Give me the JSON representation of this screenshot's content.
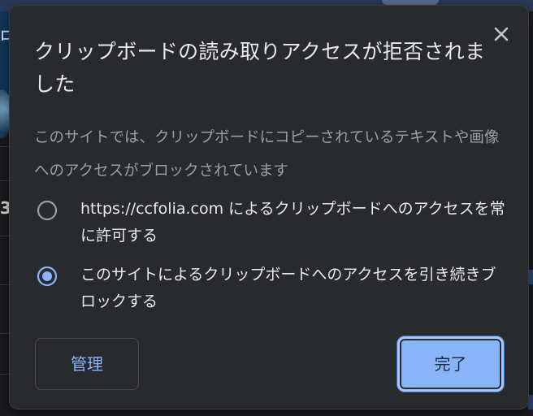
{
  "dialog": {
    "title": "クリップボードの読み取りアクセスが拒否されました",
    "description": "このサイトでは、クリップボードにコピーされているテキストや画像へのアクセスがブロックされています",
    "close_icon": "close-icon",
    "options": [
      {
        "label": "https://ccfolia.com によるクリップボードへのアクセスを常に許可する",
        "selected": false
      },
      {
        "label": "このサイトによるクリップボードへのアクセスを引き続きブロックする",
        "selected": true
      }
    ],
    "manage_label": "管理",
    "done_label": "完了"
  },
  "background": {
    "strip_char": "ロ",
    "digit": "3"
  },
  "colors": {
    "dialog_bg": "#292a2d",
    "accent": "#8ab4f8",
    "text_primary": "#e8eaed",
    "text_secondary": "#9aa0a6"
  }
}
